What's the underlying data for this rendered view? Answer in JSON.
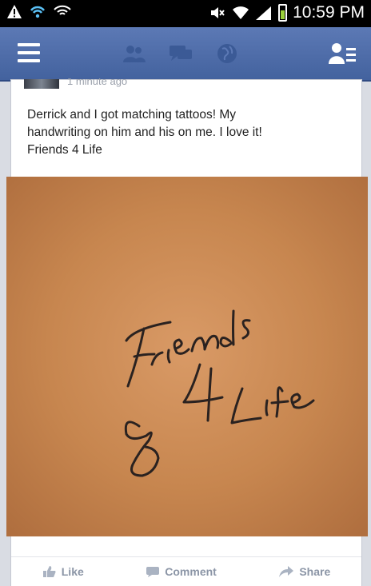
{
  "status_bar": {
    "time": "10:59 PM"
  },
  "post": {
    "timestamp": "1 minute ago",
    "text_line1": "Derrick and I got matching tattoos!  My",
    "text_line2": "handwriting on him and his on me. I love it!",
    "text_line3": "Friends 4 Life"
  },
  "tattoo": {
    "line1": "Friends",
    "line2_num": "4",
    "line2_word": "Life"
  },
  "actions": {
    "like": "Like",
    "comment": "Comment",
    "share": "Share"
  },
  "colors": {
    "fb_blue": "#4a67a3",
    "skin": "#c98a55",
    "ink": "#2a2220"
  }
}
